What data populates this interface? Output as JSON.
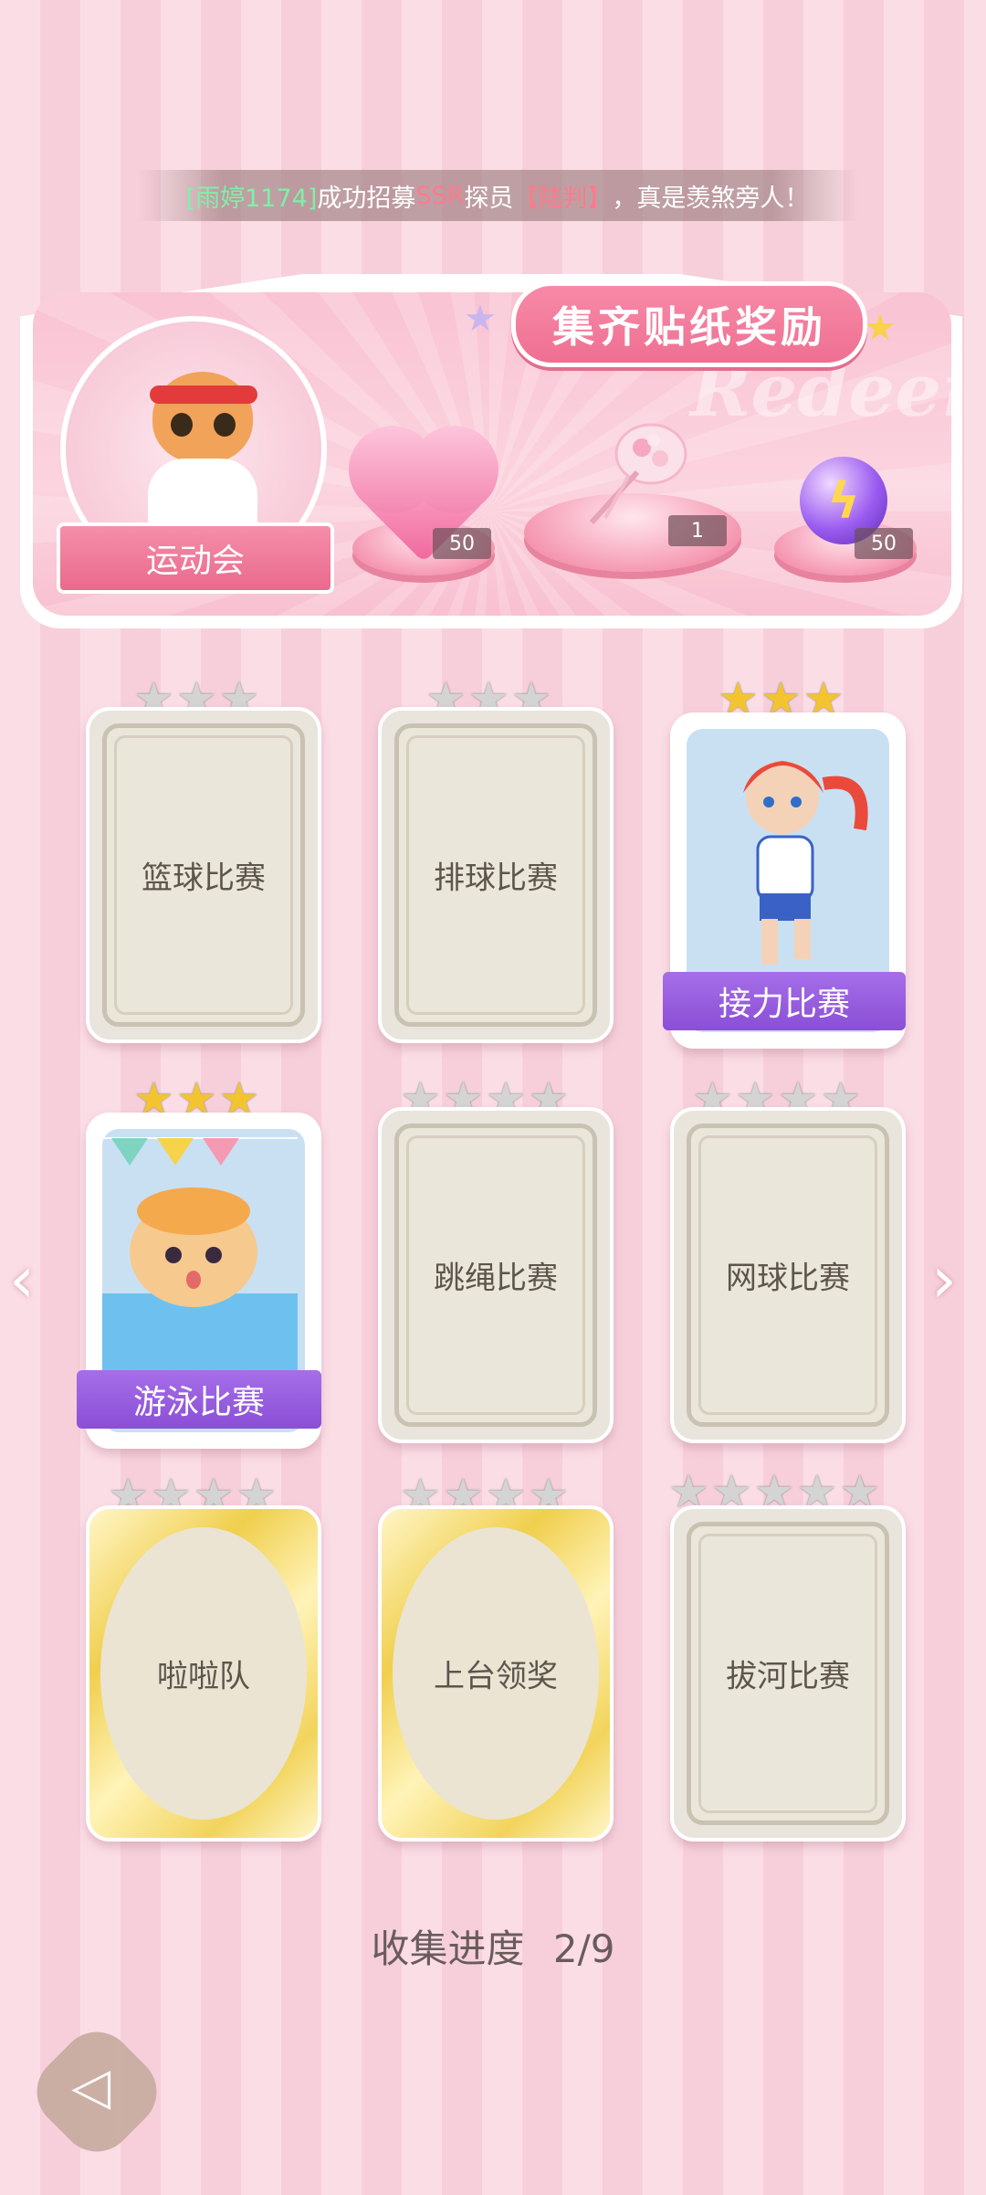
{
  "ticker": {
    "user": "[雨婷1174]",
    "text1": "成功招募",
    "rarity": "SSR",
    "text2": "探员",
    "character": "【陆判】",
    "text3": "，真是羡煞旁人！"
  },
  "banner": {
    "title": "集齐贴纸奖励",
    "watermark": "Redeem",
    "event_name": "运动会",
    "rewards": [
      {
        "icon": "pink-heart-gem-icon",
        "count": "50"
      },
      {
        "icon": "bouquet-icon",
        "count": "1"
      },
      {
        "icon": "purple-lightning-orb-icon",
        "count": "50"
      }
    ]
  },
  "stickers": [
    {
      "name": "篮球比赛",
      "stars_total": 3,
      "stars_earned": 0,
      "collected": false
    },
    {
      "name": "排球比赛",
      "stars_total": 3,
      "stars_earned": 0,
      "collected": false
    },
    {
      "name": "接力比赛",
      "stars_total": 3,
      "stars_earned": 3,
      "collected": true
    },
    {
      "name": "游泳比赛",
      "stars_total": 3,
      "stars_earned": 3,
      "collected": true
    },
    {
      "name": "跳绳比赛",
      "stars_total": 4,
      "stars_earned": 0,
      "collected": false
    },
    {
      "name": "网球比赛",
      "stars_total": 4,
      "stars_earned": 0,
      "collected": false
    },
    {
      "name": "啦啦队",
      "stars_total": 4,
      "stars_earned": 0,
      "collected": false
    },
    {
      "name": "上台领奖",
      "stars_total": 4,
      "stars_earned": 0,
      "collected": false
    },
    {
      "name": "拔河比赛",
      "stars_total": 5,
      "stars_earned": 0,
      "collected": false
    }
  ],
  "progress": {
    "label": "收集进度",
    "value": "2/9"
  },
  "colors": {
    "accent_pink": "#ef6f92",
    "ribbon_purple": "#8a4fd6",
    "star_gold": "#f4c430"
  }
}
